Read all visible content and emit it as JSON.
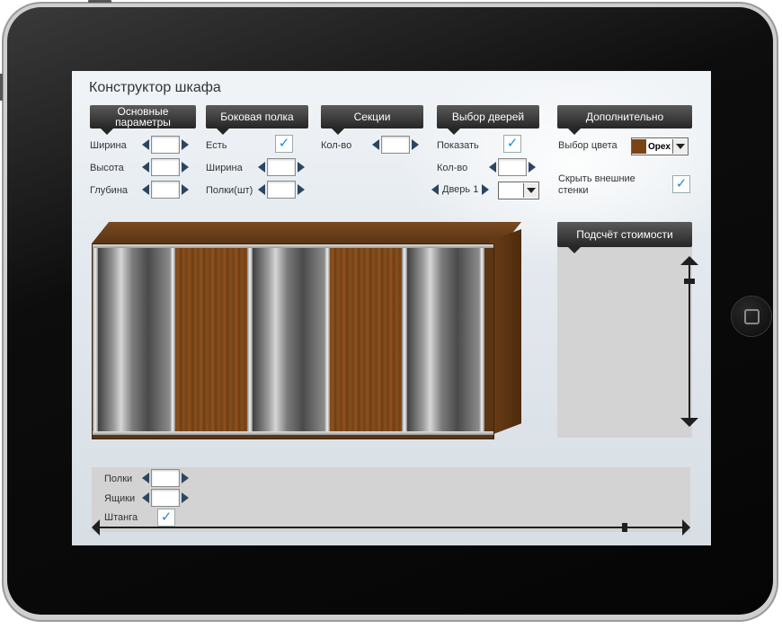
{
  "app": {
    "title": "Конструктор шкафа"
  },
  "sections": {
    "main": {
      "header": "Основные параметры",
      "width_label": "Ширина",
      "height_label": "Высота",
      "depth_label": "Глубина"
    },
    "side_shelf": {
      "header": "Боковая полка",
      "present_label": "Есть",
      "present_checked": true,
      "width_label": "Ширина",
      "shelves_label": "Полки(шт)"
    },
    "sections": {
      "header": "Секции",
      "count_label": "Кол-во"
    },
    "doors": {
      "header": "Выбор дверей",
      "show_label": "Показать",
      "show_checked": true,
      "count_label": "Кол-во",
      "door_select_label": "Дверь 1"
    },
    "extra": {
      "header": "Дополнительно",
      "color_label": "Выбор цвета",
      "color_value": "Орех",
      "hide_walls_label": "Скрыть внешние стенки",
      "hide_walls_checked": true
    }
  },
  "price": {
    "header": "Подсчёт стоимости"
  },
  "bottom": {
    "shelves_label": "Полки",
    "drawers_label": "Ящики",
    "rod_label": "Штанга",
    "rod_checked": true
  },
  "icons": {
    "check": "✓"
  },
  "colors": {
    "accent": "#1d8fd6",
    "header_bg": "#2f2f2f",
    "wood": "#7a4416",
    "arrow": "#2a4660"
  }
}
